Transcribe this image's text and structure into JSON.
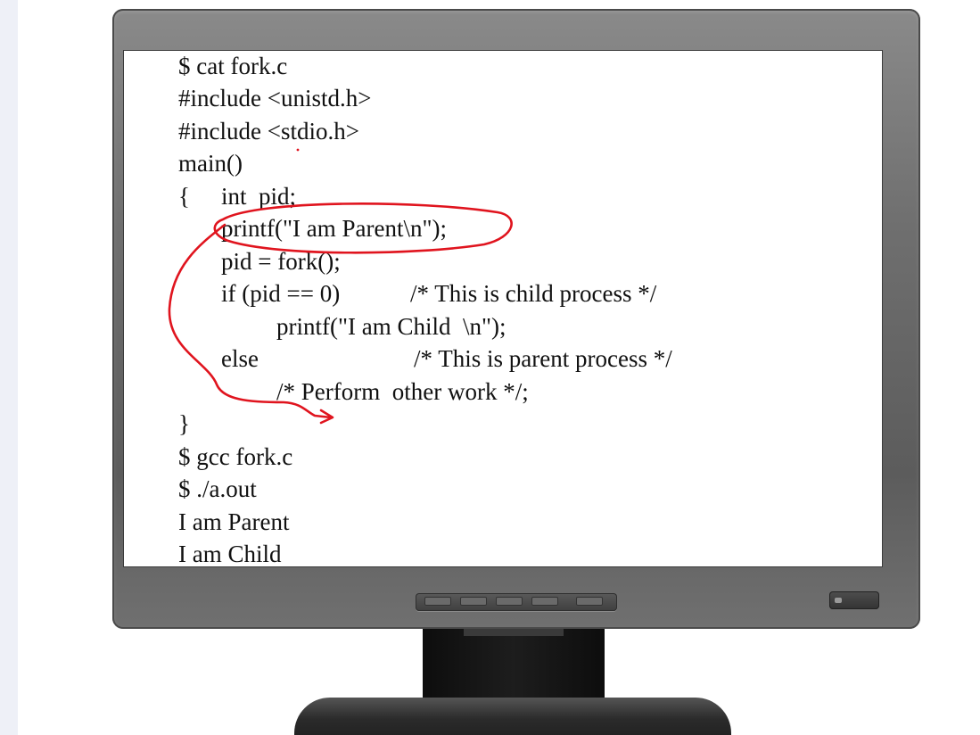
{
  "terminal": {
    "lines": [
      "$ cat fork.c",
      "#include <unistd.h>",
      "#include <stdio.h>",
      "main()",
      "{",
      "int  pid;",
      "printf(\"I am Parent\\n\");",
      "pid = fork();",
      "if (pid == 0)",
      "printf(\"I am Child  \\n\");",
      "else",
      "/* Perform  other work */;",
      "}",
      "$ gcc fork.c",
      "$ ./a.out",
      "I am Parent",
      "I am Child"
    ],
    "comments": {
      "child": "/* This is child process */",
      "parent": "/* This is parent process */"
    }
  },
  "colors": {
    "annotation": "#e0141e",
    "screen_text": "#111111",
    "bezel": "#6f6f6f"
  },
  "icons": {
    "power": "power-button-icon"
  }
}
